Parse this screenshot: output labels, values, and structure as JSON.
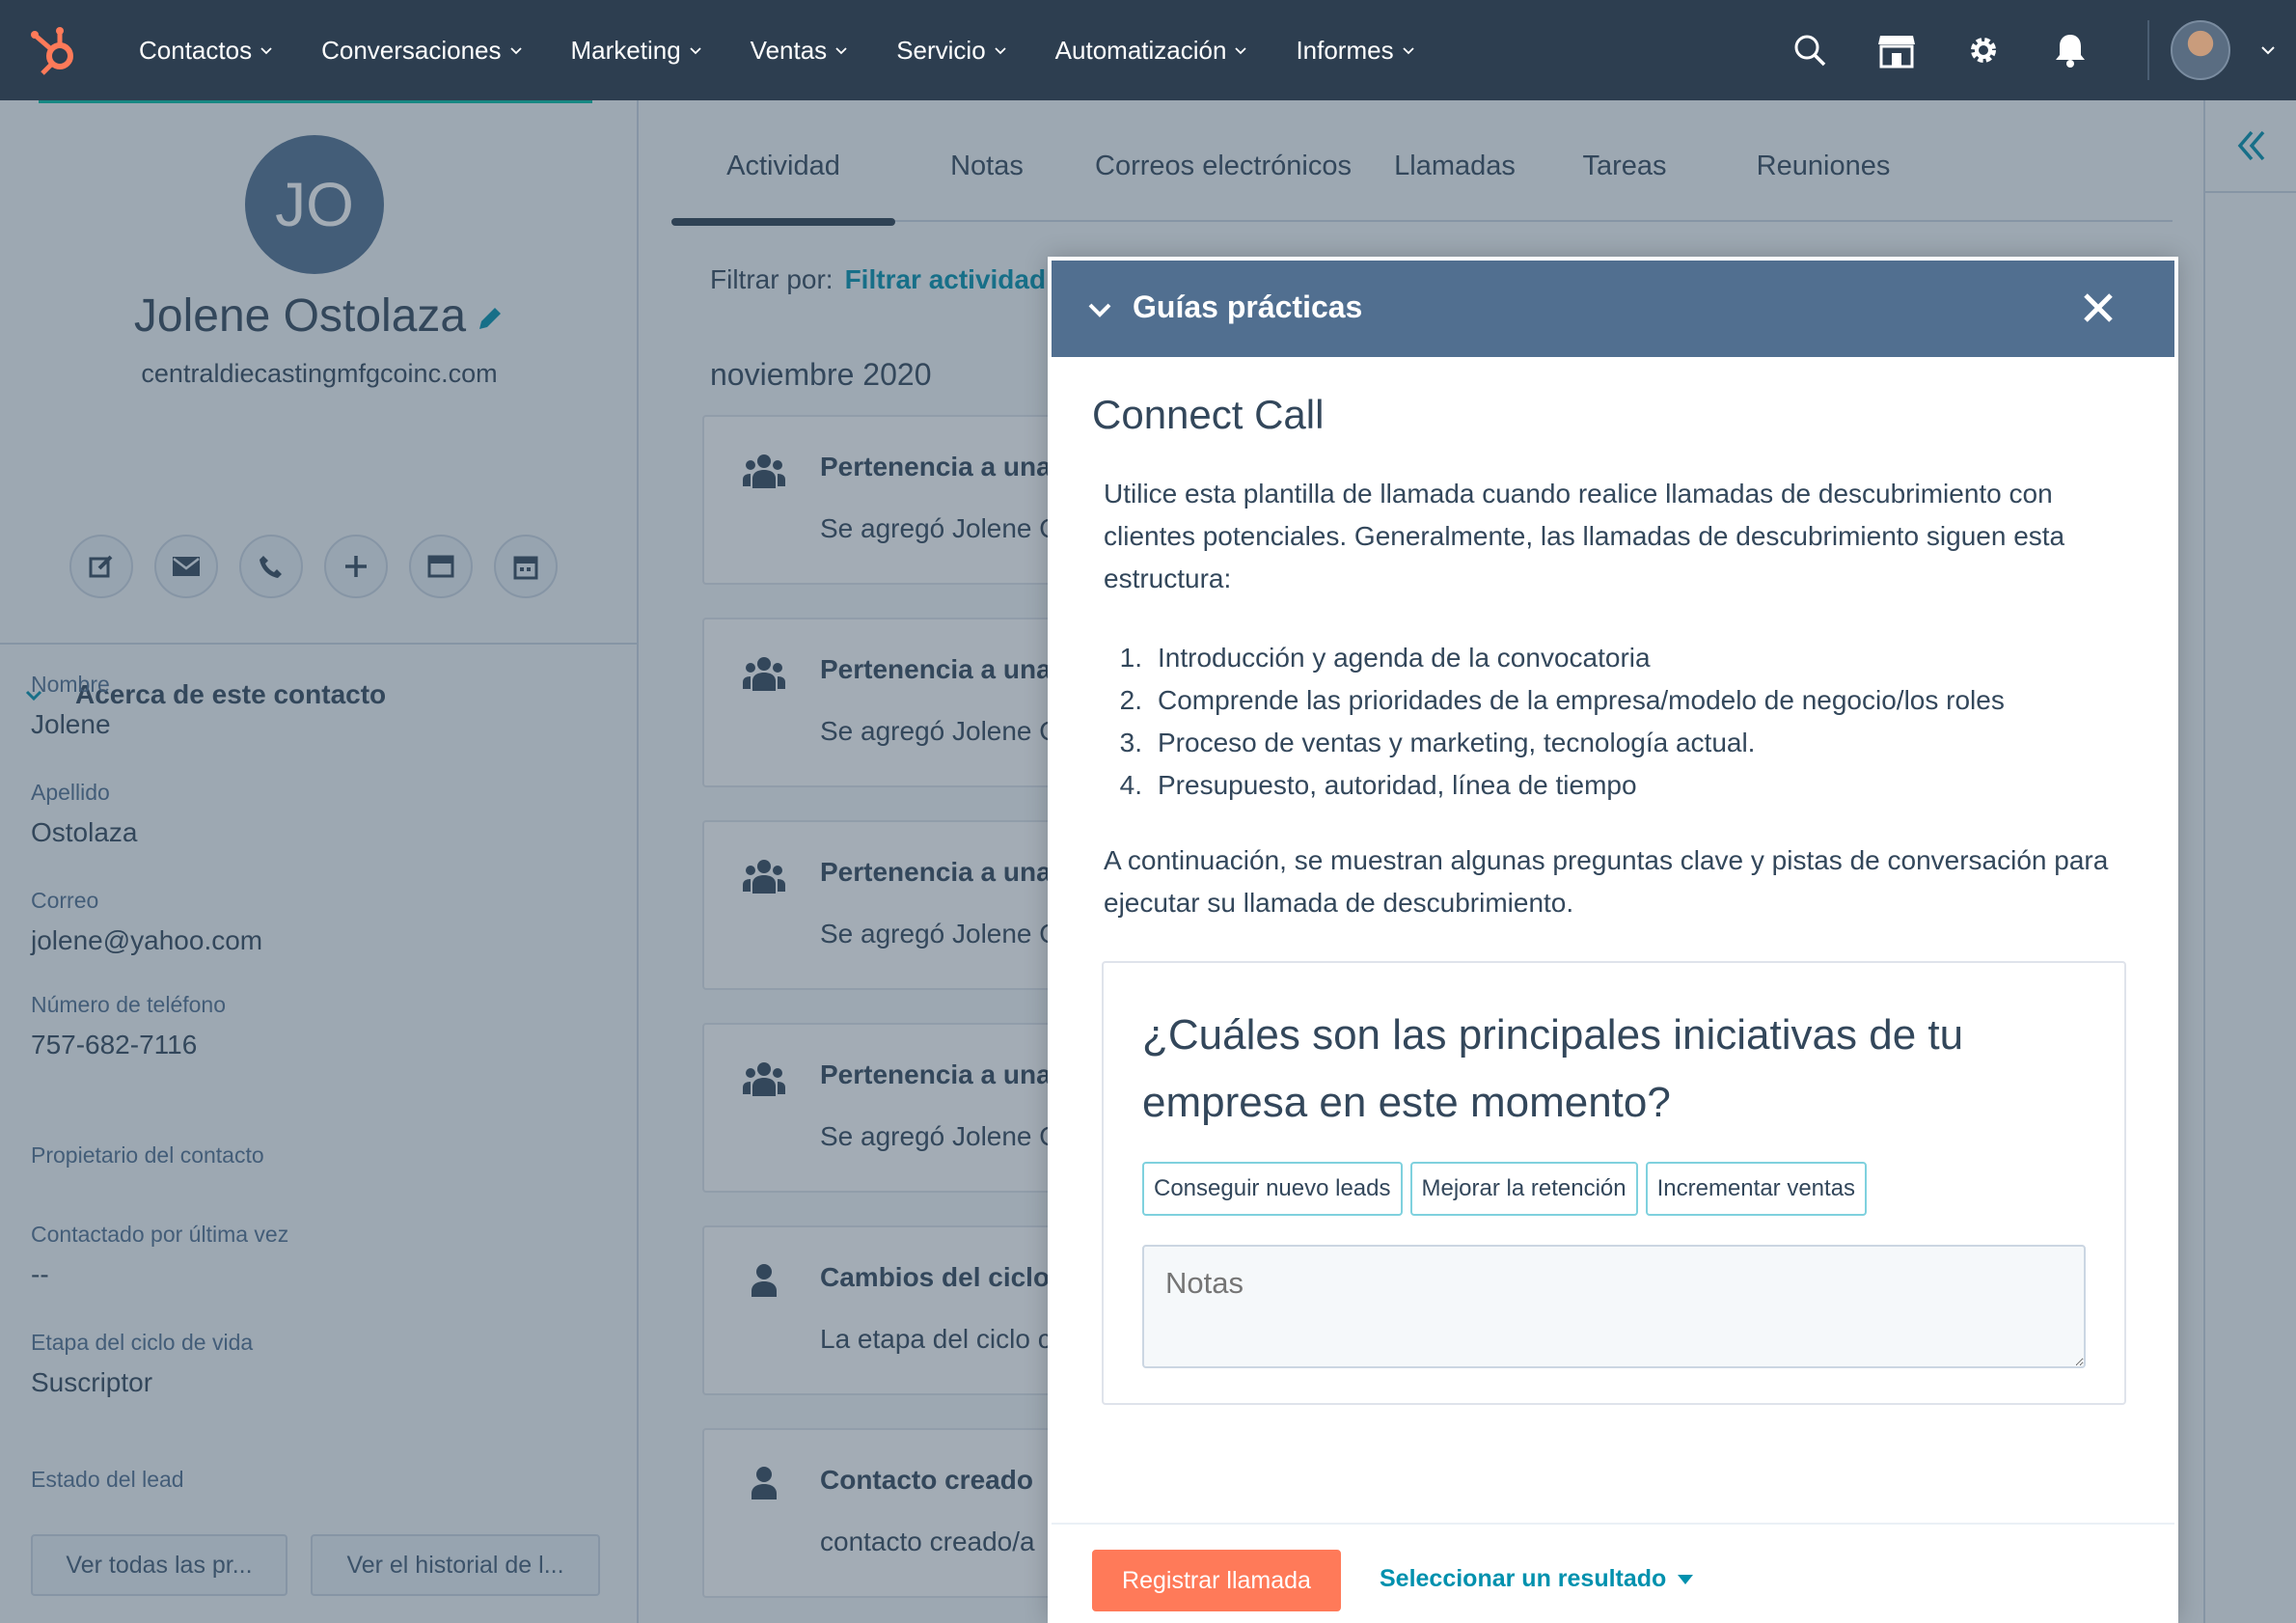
{
  "nav": {
    "items": [
      "Contactos",
      "Conversaciones",
      "Marketing",
      "Ventas",
      "Servicio",
      "Automatización",
      "Informes"
    ],
    "icons": [
      "search-icon",
      "marketplace-icon",
      "gear-icon",
      "bell-icon"
    ]
  },
  "contact": {
    "initials": "JO",
    "name": "Jolene Ostolaza",
    "domain": "centraldiecastingmfgcoinc.com",
    "actions": [
      "note-icon",
      "email-icon",
      "phone-icon",
      "plus-icon",
      "window-icon",
      "calendar-icon"
    ]
  },
  "about": {
    "title": "Acerca de este contacto",
    "properties": [
      {
        "label": "Nombre",
        "value": "Jolene"
      },
      {
        "label": "Apellido",
        "value": "Ostolaza"
      },
      {
        "label": "Correo",
        "value": "jolene@yahoo.com"
      },
      {
        "label": "Número de teléfono",
        "value": "757-682-7116"
      },
      {
        "label": "Propietario del contacto",
        "value": ""
      },
      {
        "label": "Contactado por última vez",
        "value": "--"
      },
      {
        "label": "Etapa del ciclo de vida",
        "value": "Suscriptor"
      },
      {
        "label": "Estado del lead",
        "value": ""
      }
    ],
    "btn_all": "Ver todas las pr...",
    "btn_history": "Ver el historial de l..."
  },
  "tabs": [
    "Actividad",
    "Notas",
    "Correos electrónicos",
    "Llamadas",
    "Tareas",
    "Reuniones"
  ],
  "filter": {
    "label": "Filtrar por:",
    "link": "Filtrar actividad"
  },
  "timeline": {
    "month": "noviembre 2020",
    "cards": [
      {
        "title": "Pertenencia a una l",
        "body": "Se agregó Jolene O",
        "icon": "group-icon"
      },
      {
        "title": "Pertenencia a una l",
        "body": "Se agregó Jolene O",
        "icon": "group-icon"
      },
      {
        "title": "Pertenencia a una l",
        "body": "Se agregó Jolene O",
        "icon": "group-icon"
      },
      {
        "title": "Pertenencia a una l",
        "body": "Se agregó Jolene O",
        "icon": "group-icon"
      },
      {
        "title": "Cambios del ciclo c",
        "body": "La etapa del ciclo c",
        "icon": "person-icon"
      },
      {
        "title": "Contacto creado",
        "body": "contacto creado/a",
        "icon": "person-icon"
      }
    ]
  },
  "modal": {
    "header": "Guías prácticas",
    "title": "Connect Call",
    "intro": "Utilice esta plantilla de llamada cuando realice llamadas de descubrimiento con clientes potenciales. Generalmente, las llamadas de descubrimiento siguen esta estructura:",
    "steps": [
      "Introducción y agenda de la convocatoria",
      "Comprende las prioridades de la empresa/modelo de negocio/los roles",
      "Proceso de ventas y marketing, tecnología actual.",
      "Presupuesto, autoridad, línea de tiempo"
    ],
    "outro": "A continuación, se muestran algunas preguntas clave y pistas de conversación para ejecutar su llamada de descubrimiento.",
    "question": "¿Cuáles son las principales iniciativas de tu empresa en este momento?",
    "chips": [
      "Conseguir nuevo leads",
      "Mejorar la retención",
      "Incrementar ventas"
    ],
    "notes_placeholder": "Notas",
    "primary_button": "Registrar llamada",
    "outcome_select": "Seleccionar un resultado"
  },
  "colors": {
    "nav_bg": "#2d3e50",
    "accent_teal": "#0091ae",
    "primary_orange": "#ff7a59",
    "modal_header": "#516f90"
  }
}
